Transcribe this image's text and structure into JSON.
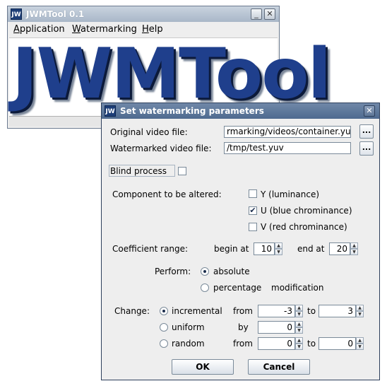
{
  "main_window": {
    "title": "JWMTool 0.1",
    "app_icon": "JW",
    "menu": [
      {
        "label": "Application"
      },
      {
        "label": "Watermarking"
      },
      {
        "label": "Help"
      }
    ],
    "logo": "JWMTool"
  },
  "dialog": {
    "title": "Set watermarking parameters",
    "app_icon": "JW",
    "original_label": "Original video file:",
    "original_value": "/home/kuku/watermarking/videos/container.yuv",
    "original_visible": "rmarking/videos/container.yuv",
    "watermarked_label": "Watermarked video file:",
    "watermarked_value": "/tmp/test.yuv",
    "browse_label": "...",
    "blind_label": "Blind process",
    "blind_checked": false,
    "component_label": "Component to be altered:",
    "components": [
      {
        "label": "Y (luminance)",
        "checked": false
      },
      {
        "label": "U (blue chrominance)",
        "checked": true
      },
      {
        "label": "V (red chrominance)",
        "checked": false
      }
    ],
    "coef_label": "Coefficient range:",
    "begin_label": "begin at",
    "begin_value": "10",
    "end_label": "end at",
    "end_value": "20",
    "perform_label": "Perform:",
    "perform_options": [
      {
        "label": "absolute",
        "selected": true
      },
      {
        "label": "percentage",
        "selected": false
      }
    ],
    "modification_label": "modification",
    "change_label": "Change:",
    "change_rows": [
      {
        "label": "incremental",
        "selected": true,
        "from_label": "from",
        "from_value": "-3",
        "to_label": "to",
        "to_value": "3"
      },
      {
        "label": "uniform",
        "selected": false,
        "by_label": "by",
        "by_value": "0"
      },
      {
        "label": "random",
        "selected": false,
        "from_label": "from",
        "from_value": "0",
        "to_label": "to",
        "to_value": "0"
      }
    ],
    "ok_label": "OK",
    "cancel_label": "Cancel"
  },
  "colors": {
    "logo_blue": "#1f3f8c",
    "titlebar_active": "#4e6a8f",
    "titlebar_inactive": "#a9b7c8"
  }
}
